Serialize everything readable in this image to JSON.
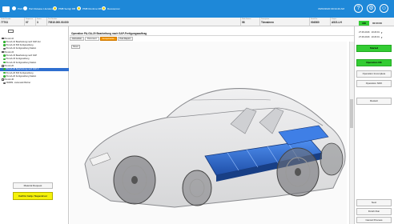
{
  "topbar": {
    "items": [
      {
        "label": "P&O",
        "dot": "w"
      },
      {
        "label": "Part Release Literature",
        "dot": "w"
      },
      {
        "label": "PMB Sertigt DB",
        "dot": "y"
      },
      {
        "label": "PMB Runtime DB",
        "dot": "y"
      },
      {
        "label": "Ressourcen",
        "dot": "y"
      }
    ],
    "datetime": "06/03/2020 09:34:40 AM",
    "icons": [
      "help-icon",
      "settings-gear-icon",
      "user-icon"
    ]
  },
  "info": {
    "fields": [
      {
        "label": "Order Number",
        "value": "77703"
      },
      {
        "label": "Sequence",
        "value": "07"
      },
      {
        "label": "Series",
        "value": "3"
      },
      {
        "label": "Part Number",
        "value": "70510.000.00.000"
      },
      {
        "label": "Work Station",
        "value": "98"
      },
      {
        "label": "Description",
        "value": "Tärvaleren"
      },
      {
        "label": "Serial No",
        "value": "004560"
      },
      {
        "label": "Project",
        "value": "A521.LH"
      }
    ],
    "summary_badge": "186",
    "summary_time": "00:00:00"
  },
  "sidebar": {
    "items": [
      {
        "label": "PA-GA-10",
        "kind": "group",
        "indent": 2
      },
      {
        "label": "PA-GA-10 Bearbeitung nach SAP-Fer",
        "kind": "done",
        "indent": 4
      },
      {
        "label": "PA-GA-10 600 Fertigmeldung",
        "kind": "done",
        "indent": 4
      },
      {
        "label": "PA-GA-10 Fertigmeldung Station",
        "kind": "open",
        "indent": 4
      },
      {
        "label": "PA-GA-15",
        "kind": "group",
        "indent": 2
      },
      {
        "label": "PA-GA-15 Bearbeitung nach SAP",
        "kind": "done",
        "indent": 4
      },
      {
        "label": "PA-GA-15 Fertigmeldung",
        "kind": "done",
        "indent": 4
      },
      {
        "label": "PA-GA-15 Fertigmeldung Station",
        "kind": "done",
        "indent": 4
      },
      {
        "label": "PA-GA-20",
        "kind": "group",
        "indent": 2
      },
      {
        "label": "PA-GA-20 Bearbeitung nach SAP-F",
        "kind": "selected",
        "indent": 4
      },
      {
        "label": "PA-GA-20 600 Fertigmeldung",
        "kind": "done",
        "indent": 4
      },
      {
        "label": "PA-GA-20 Fertigmeldung Station",
        "kind": "done",
        "indent": 4
      },
      {
        "label": "PA-GA-40",
        "kind": "group",
        "indent": 2
      },
      {
        "label": "OM489 - Automatic Bohrer",
        "kind": "open",
        "indent": 4
      }
    ],
    "material_button": "Material Request",
    "help_button": "Call for Help / Supervisor"
  },
  "main": {
    "operation_title": "Operation PA-GA-20 Bearbeitung nach SAP-Fertigungsauftrag",
    "tabs": [
      "Instruction",
      "Document",
      "Komponente",
      "Part Report"
    ],
    "reset_label": "Reset"
  },
  "right": {
    "timestamps": [
      {
        "date": "27.06.2016",
        "time": "10:23:01"
      },
      {
        "date": "27.06.2016",
        "time": "10:23:01"
      }
    ],
    "buttons_top": [
      {
        "label": "Started",
        "style": "green"
      },
      {
        "label": "Operation OK",
        "style": "green"
      },
      {
        "label": "Operation Incomplete",
        "style": "plain"
      },
      {
        "label": "Operation NOK",
        "style": "plain"
      },
      {
        "label": "Restart",
        "style": "plain"
      }
    ],
    "buttons_bottom": [
      "Next",
      "Finish Run",
      "Cancel Process"
    ]
  },
  "colors": {
    "topbar": "#1e88d8",
    "green": "#33cc33",
    "help_yellow": "#f5f20a",
    "tab_orange": "#f29300",
    "selection": "#2f6fd0"
  }
}
